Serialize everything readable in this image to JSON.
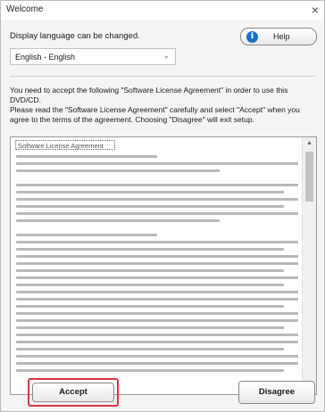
{
  "window": {
    "title": "Welcome",
    "close_glyph": "×"
  },
  "language": {
    "label": "Display language can be changed.",
    "selected": "English - English",
    "arrow_glyph": "⌄"
  },
  "help": {
    "icon_glyph": "i",
    "label": "Help",
    "icon_color": "#1b6fc8"
  },
  "instructions": {
    "paragraph1": "You need to accept the following \"Software License Agreement\" in order to use this DVD/CD.",
    "paragraph2": "Please read the \"Software License Agreement\" carefully and select \"Accept\" when you agree to the terms of the agreement. Choosing \"Disagree\" will exit setup."
  },
  "license": {
    "title": "Software License Agreement",
    "scroll_up_glyph": "▲",
    "scroll_down_glyph": "▼"
  },
  "buttons": {
    "accept": "Accept",
    "disagree": "Disagree",
    "highlight_color": "#d9363e"
  }
}
